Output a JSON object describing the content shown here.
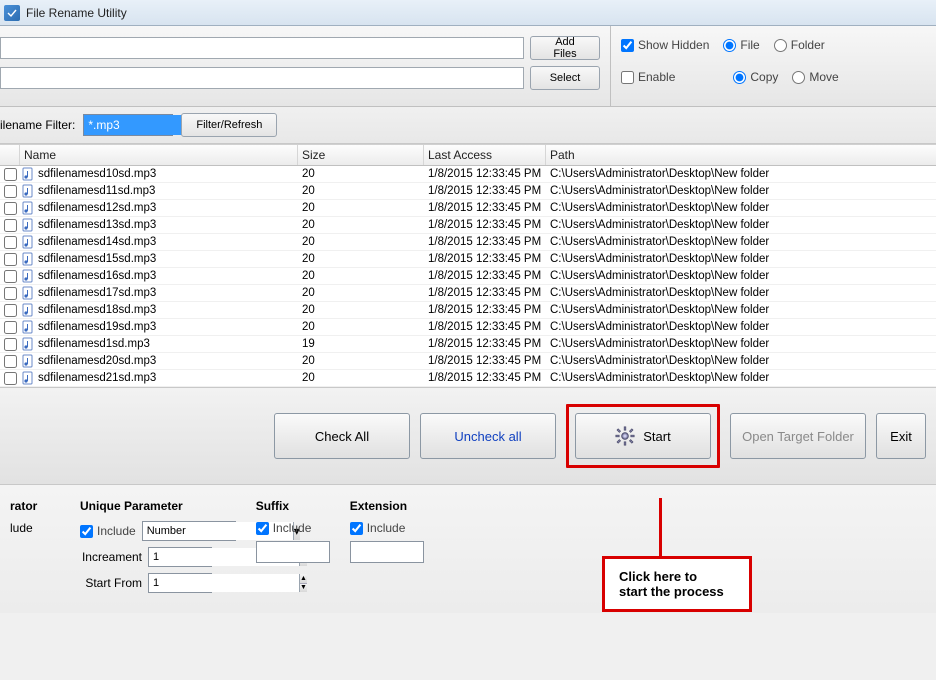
{
  "window": {
    "title": "File Rename Utility"
  },
  "top": {
    "add_files": "Add Files",
    "select": "Select",
    "show_hidden": "Show Hidden",
    "file": "File",
    "folder": "Folder",
    "enable": "Enable",
    "copy": "Copy",
    "move": "Move"
  },
  "filter": {
    "label": "ilename Filter:",
    "value": "*.mp3",
    "button": "Filter/Refresh"
  },
  "columns": {
    "name": "Name",
    "size": "Size",
    "last": "Last Access",
    "path": "Path"
  },
  "rows": [
    {
      "name": "sdfilenamesd10sd.mp3",
      "size": "20",
      "last": "1/8/2015 12:33:45 PM",
      "path": "C:\\Users\\Administrator\\Desktop\\New folder"
    },
    {
      "name": "sdfilenamesd11sd.mp3",
      "size": "20",
      "last": "1/8/2015 12:33:45 PM",
      "path": "C:\\Users\\Administrator\\Desktop\\New folder"
    },
    {
      "name": "sdfilenamesd12sd.mp3",
      "size": "20",
      "last": "1/8/2015 12:33:45 PM",
      "path": "C:\\Users\\Administrator\\Desktop\\New folder"
    },
    {
      "name": "sdfilenamesd13sd.mp3",
      "size": "20",
      "last": "1/8/2015 12:33:45 PM",
      "path": "C:\\Users\\Administrator\\Desktop\\New folder"
    },
    {
      "name": "sdfilenamesd14sd.mp3",
      "size": "20",
      "last": "1/8/2015 12:33:45 PM",
      "path": "C:\\Users\\Administrator\\Desktop\\New folder"
    },
    {
      "name": "sdfilenamesd15sd.mp3",
      "size": "20",
      "last": "1/8/2015 12:33:45 PM",
      "path": "C:\\Users\\Administrator\\Desktop\\New folder"
    },
    {
      "name": "sdfilenamesd16sd.mp3",
      "size": "20",
      "last": "1/8/2015 12:33:45 PM",
      "path": "C:\\Users\\Administrator\\Desktop\\New folder"
    },
    {
      "name": "sdfilenamesd17sd.mp3",
      "size": "20",
      "last": "1/8/2015 12:33:45 PM",
      "path": "C:\\Users\\Administrator\\Desktop\\New folder"
    },
    {
      "name": "sdfilenamesd18sd.mp3",
      "size": "20",
      "last": "1/8/2015 12:33:45 PM",
      "path": "C:\\Users\\Administrator\\Desktop\\New folder"
    },
    {
      "name": "sdfilenamesd19sd.mp3",
      "size": "20",
      "last": "1/8/2015 12:33:45 PM",
      "path": "C:\\Users\\Administrator\\Desktop\\New folder"
    },
    {
      "name": "sdfilenamesd1sd.mp3",
      "size": "19",
      "last": "1/8/2015 12:33:45 PM",
      "path": "C:\\Users\\Administrator\\Desktop\\New folder"
    },
    {
      "name": "sdfilenamesd20sd.mp3",
      "size": "20",
      "last": "1/8/2015 12:33:45 PM",
      "path": "C:\\Users\\Administrator\\Desktop\\New folder"
    },
    {
      "name": "sdfilenamesd21sd.mp3",
      "size": "20",
      "last": "1/8/2015 12:33:45 PM",
      "path": "C:\\Users\\Administrator\\Desktop\\New folder"
    }
  ],
  "actions": {
    "check_all": "Check All",
    "uncheck_all": "Uncheck all",
    "start": "Start",
    "open_target": "Open Target Folder",
    "exit": "Exit"
  },
  "bottom": {
    "rator_title": "rator",
    "rator_lude": "lude",
    "unique_title": "Unique Parameter",
    "include": "Include",
    "number": "Number",
    "increament": "Increament",
    "increment_val": "1",
    "start_from": "Start From",
    "start_from_val": "1",
    "suffix_title": "Suffix",
    "suffix_val": "",
    "extension_title": "Extension",
    "extension_val": ""
  },
  "callout": {
    "line1": "Click here to",
    "line2": "start the process"
  }
}
